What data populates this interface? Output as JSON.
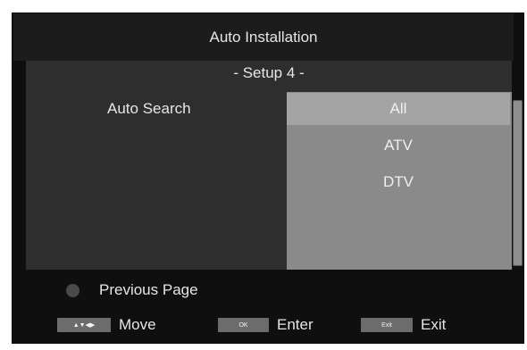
{
  "header": {
    "title": "Auto Installation"
  },
  "setup": {
    "label": "- Setup 4 -"
  },
  "auto_search": {
    "label": "Auto Search",
    "options": [
      "All",
      "ATV",
      "DTV"
    ],
    "selected": "All"
  },
  "footer": {
    "previous_page": "Previous Page",
    "move_keys": "▲▼◀▶",
    "move_label": "Move",
    "ok_key": "OK",
    "enter_label": "Enter",
    "exit_key": "Exit",
    "exit_label": "Exit"
  },
  "colors": {
    "background": "#0f0f0f",
    "panel": "#2e2e2e",
    "selected": "#a4a4a4",
    "list": "#8a8a8a"
  }
}
